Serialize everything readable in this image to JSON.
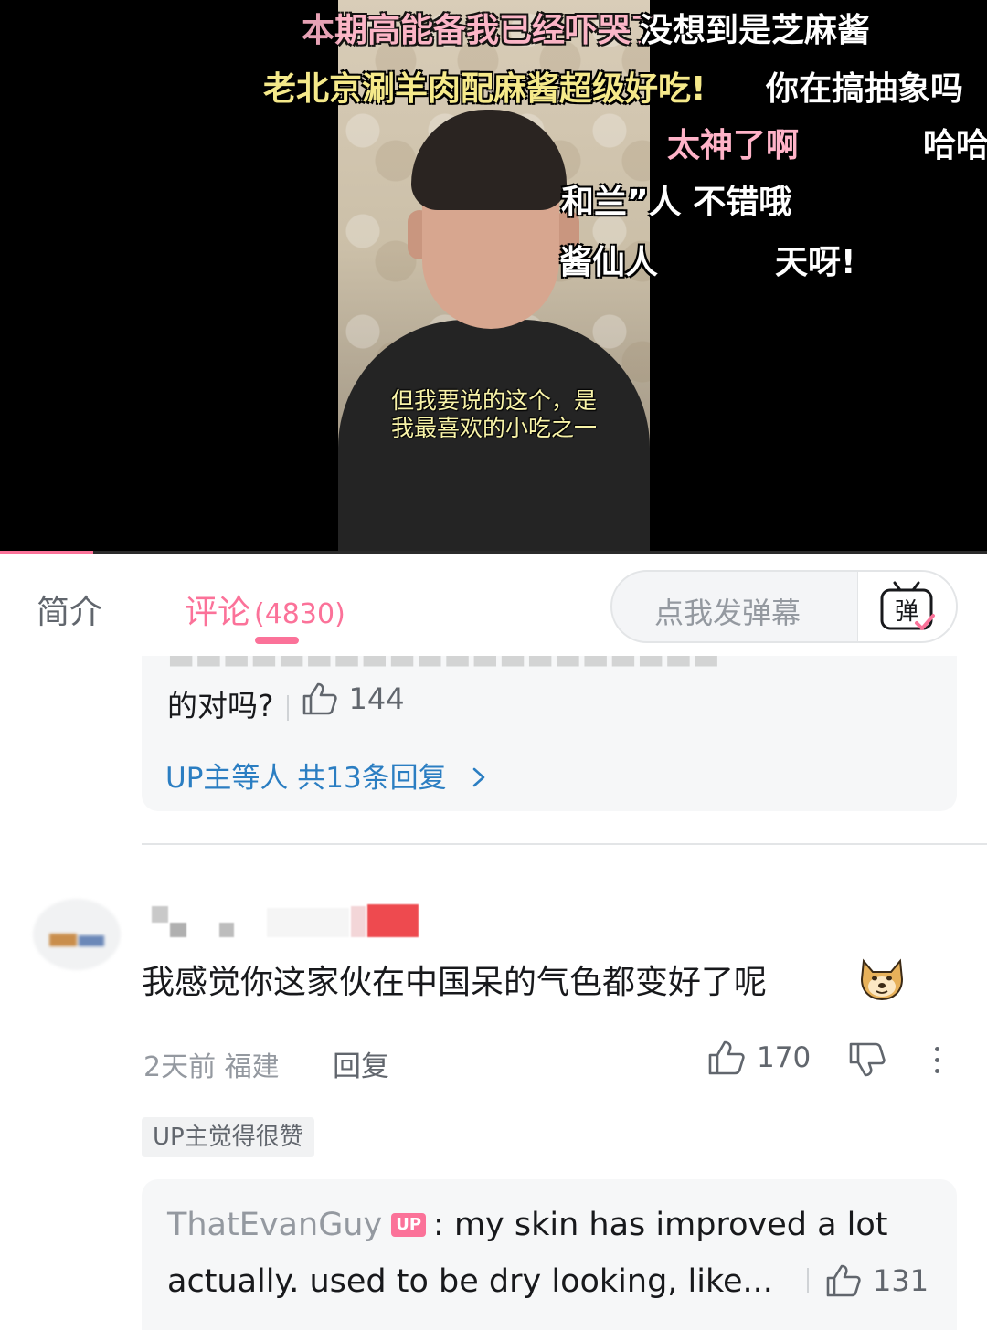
{
  "video": {
    "subtitle_lines": [
      "但我要说的这个，是",
      "我最喜欢的小吃之一"
    ],
    "danmaku": [
      {
        "text": "本期高能备我已经吓哭了",
        "color": "#ffb3c8"
      },
      {
        "text": "没想到是芝麻酱",
        "color": "#ffffff"
      },
      {
        "text": "老北京涮羊肉配麻酱超级好吃!",
        "color": "#f5e98a"
      },
      {
        "text": "你在搞抽象吗",
        "color": "#ffffff"
      },
      {
        "text": "太神了啊",
        "color": "#ffb3c8"
      },
      {
        "text": "哈哈",
        "color": "#ffffff"
      },
      {
        "text": "和兰”人 不错哦",
        "color": "#ffffff"
      },
      {
        "text": "酱仙人",
        "color": "#ffffff"
      },
      {
        "text": "天呀!",
        "color": "#ffffff"
      }
    ],
    "progress_fraction": 0.094
  },
  "tabs": {
    "intro_label": "简介",
    "comments_label": "评论",
    "comments_count": "(4830)",
    "danmaku_placeholder": "点我发弹幕",
    "danmaku_icon_label": "弹"
  },
  "prev_comment": {
    "tail_text": "的对吗?",
    "like_count": "144",
    "view_replies_label": "UP主等人 共13条回复"
  },
  "comment": {
    "text": "我感觉你这家伙在中国呆的气色都变好了呢",
    "emoji": "doge-icon",
    "time": "2天前",
    "location": "福建",
    "reply_label": "回复",
    "like_count": "170",
    "up_tag_label": "UP主觉得很赞"
  },
  "sub_reply": {
    "author": "ThatEvanGuy",
    "up_badge": "UP",
    "line1": ": my skin has improved a lot",
    "line2": "actually. used to be dry looking, like...",
    "like_count": "131"
  },
  "colors": {
    "accent": "#fb7299",
    "link": "#2b7ec2",
    "muted": "#9499a0"
  }
}
